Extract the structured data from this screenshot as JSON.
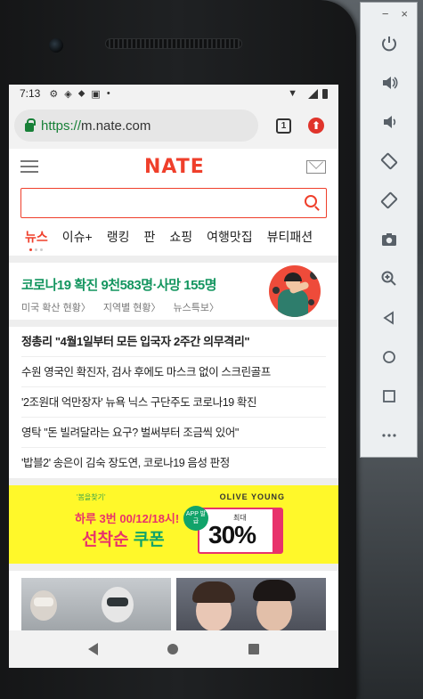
{
  "status_bar": {
    "time": "7:13"
  },
  "browser": {
    "url_scheme": "https://",
    "url_host": "m.nate.com",
    "tab_count": "1"
  },
  "nate": {
    "logo": "NATE",
    "search_placeholder": "",
    "tabs": [
      "뉴스",
      "이슈+",
      "랭킹",
      "판",
      "쇼핑",
      "여행맛집",
      "뷰티패션"
    ],
    "covid": {
      "title": "코로나19 확진 9천583명·사망 155명",
      "links": [
        "미국 확산 현황〉",
        "지역별 현황〉",
        "뉴스특보〉"
      ]
    },
    "headlines": [
      "정총리 \"4월1일부터 모든 입국자 2주간 의무격리\"",
      "수원 영국인 확진자, 검사 후에도 마스크 없이 스크린골프",
      "'2조원대 억만장자' 뉴욕 닉스 구단주도 코로나19 확진",
      "영탁 \"돈 빌려달라는 요구? 벌써부터 조금씩 있어\"",
      "'밥블2' 송은이 김숙 장도연, 코로나19 음성 판정"
    ],
    "ad": {
      "brand_small": "'봄을찾기'",
      "brand_right": "OLIVE YOUNG",
      "line1": "하루 3번 00/12/18시!",
      "line2_a": "선착순",
      "line2_b": "쿠폰",
      "app_badge": "APP 발급",
      "max_label": "최대",
      "percent": "30%"
    }
  },
  "emulator": {
    "minimize": "−",
    "close": "×"
  }
}
